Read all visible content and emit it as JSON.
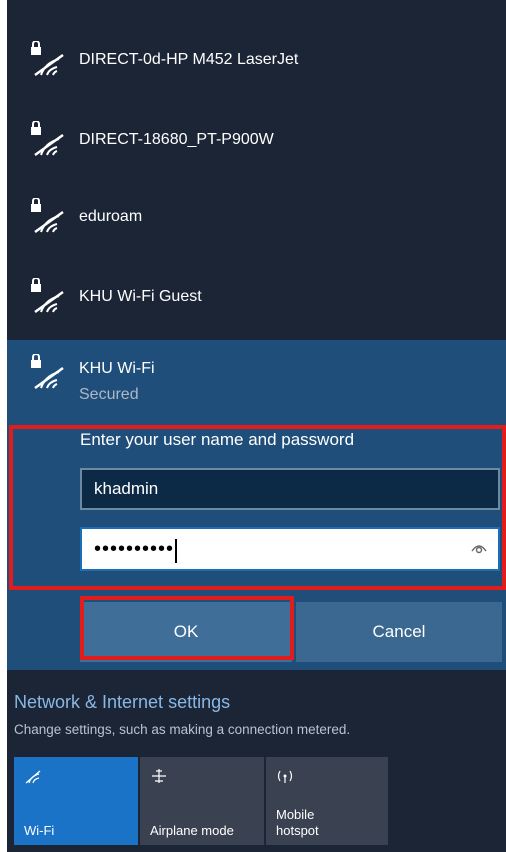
{
  "networks": [
    {
      "name": "DIRECT-0d-HP M452 LaserJet"
    },
    {
      "name": "DIRECT-18680_PT-P900W"
    },
    {
      "name": "eduroam"
    },
    {
      "name": "KHU Wi-Fi Guest"
    }
  ],
  "selected_network": {
    "name": "KHU Wi-Fi",
    "status": "Secured",
    "prompt": "Enter your user name and password",
    "username_value": "khadmin",
    "password_masked": "••••••••••",
    "ok_label": "OK",
    "cancel_label": "Cancel"
  },
  "settings": {
    "title": "Network & Internet settings",
    "subtitle": "Change settings, such as making a connection metered."
  },
  "quick_actions": [
    {
      "label": "Wi-Fi",
      "icon": "wifi-icon",
      "active": true
    },
    {
      "label": "Airplane mode",
      "icon": "airplane-icon",
      "active": false
    },
    {
      "label_line1": "Mobile",
      "label_line2": "hotspot",
      "icon": "hotspot-icon",
      "active": false
    }
  ],
  "colors": {
    "panel_bg": "#1c2536",
    "selected_bg": "#1f4e7a",
    "accent": "#1a73c7",
    "highlight": "#e21b1b"
  }
}
